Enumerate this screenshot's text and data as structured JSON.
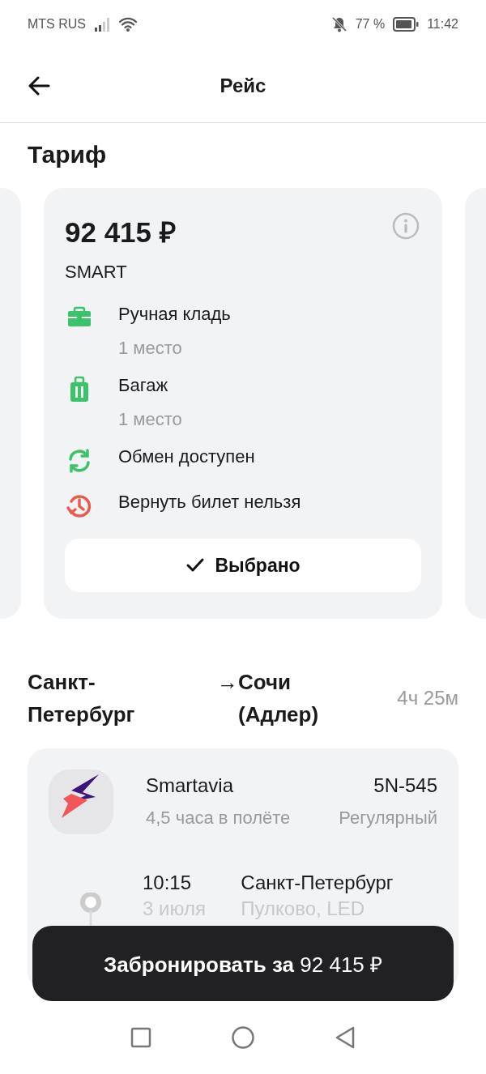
{
  "status_bar": {
    "carrier": "MTS RUS",
    "battery": "77 %",
    "time": "11:42"
  },
  "header": {
    "title": "Рейс"
  },
  "tariff_section": {
    "title": "Тариф"
  },
  "tariff": {
    "price": "92 415 ₽",
    "name": "SMART",
    "selected": true,
    "button": "Выбрано",
    "features": [
      {
        "kind": "carry_on",
        "available": true,
        "label": "Ручная кладь",
        "detail": "1 место"
      },
      {
        "kind": "baggage",
        "available": true,
        "label": "Багаж",
        "detail": "1 место"
      },
      {
        "kind": "exchange",
        "available": true,
        "label": "Обмен доступен"
      },
      {
        "kind": "refund",
        "available": false,
        "label": "Вернуть билет нельзя"
      }
    ]
  },
  "route": {
    "from": "Санкт-Петербург",
    "arrow": "→",
    "to": "Сочи (Адлер)",
    "duration": "4ч 25м"
  },
  "flight": {
    "airline": "Smartavia",
    "number": "5N-545",
    "flight_time": "4,5 часа в полёте",
    "type": "Регулярный",
    "segments": [
      {
        "time": "10:15",
        "date": "3 июля",
        "city": "Санкт-Петербург",
        "airport": "Пулково, LED"
      }
    ]
  },
  "book_button": "**Забронировать за** 92 415 ₽"
}
